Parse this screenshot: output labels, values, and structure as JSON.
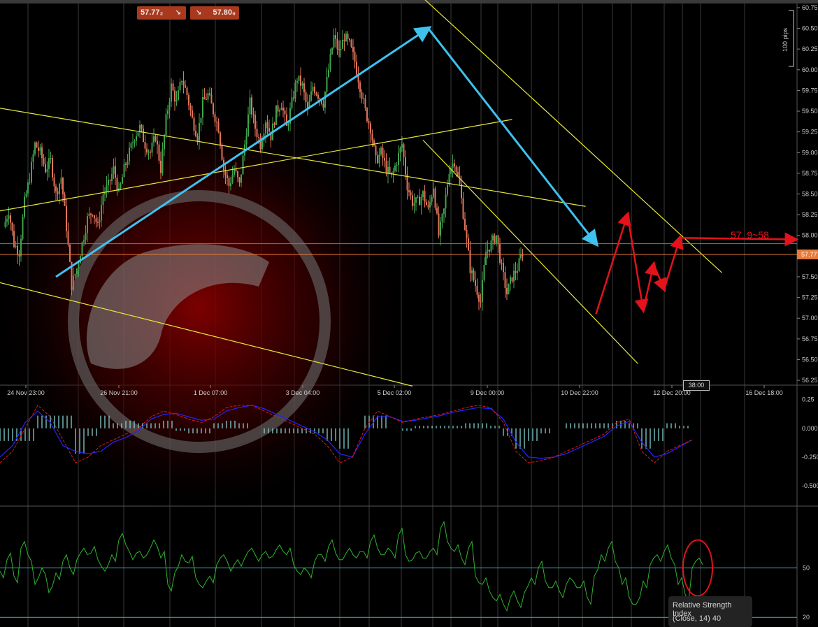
{
  "toolbar": {
    "bid_price": "57.77₂",
    "ask_price": "57.80₉",
    "bid_arrow": "↘",
    "ask_arrow": "↘"
  },
  "colors": {
    "background": "#000000",
    "candle_up": "#3fa34d",
    "candle_down": "#e0745a",
    "trend_line": "#e8e83a",
    "annotation_blue": "#3fc1ee",
    "annotation_red": "#e3121b",
    "macd_signal": "#e01818",
    "macd_line": "#2424ff",
    "macd_histogram": "#8de0e0",
    "rsi_line": "#2fb32f",
    "rsi_levels": "#3bb3d6",
    "current_price_line": "#e87a3a",
    "grid": "#6a6a6a"
  },
  "chart_data": [
    {
      "type": "candlestick",
      "title": "",
      "x_labels": [
        "24 Nov 23:00",
        "26 Nov 21:00",
        "1 Dec 07:00",
        "3 Dec 04:00",
        "5 Dec 02:00",
        "9 Dec 00:00",
        "10 Dec 22:00",
        "12 Dec 20:00",
        "16 Dec 18:00"
      ],
      "y_ticks": [
        "56.25",
        "56.50",
        "56.75",
        "57.00",
        "57.25",
        "57.50",
        "57.75",
        "58.00",
        "58.25",
        "58.50",
        "58.75",
        "59.00",
        "59.25",
        "59.50",
        "59.75",
        "60.00",
        "60.25",
        "60.50",
        "60.75"
      ],
      "ylim": [
        56.2,
        60.8
      ],
      "current_price": 57.77,
      "current_price_label": "57.77",
      "scale_label": "100 pips",
      "cursor_time": "38:00",
      "annotation_text": "57. 9~58",
      "close_path": [
        [
          0,
          58.1
        ],
        [
          1,
          58.3
        ],
        [
          2,
          57.9
        ],
        [
          3,
          57.8
        ],
        [
          4,
          58.4
        ],
        [
          5,
          58.7
        ],
        [
          6,
          59.1
        ],
        [
          7,
          59.0
        ],
        [
          8,
          58.8
        ],
        [
          9,
          58.9
        ],
        [
          10,
          58.5
        ],
        [
          11,
          58.7
        ],
        [
          12,
          58.1
        ],
        [
          13,
          57.4
        ],
        [
          14,
          57.6
        ],
        [
          15,
          57.9
        ],
        [
          16,
          58.2
        ],
        [
          17,
          58.3
        ],
        [
          18,
          58.1
        ],
        [
          19,
          58.5
        ],
        [
          20,
          58.6
        ],
        [
          21,
          58.8
        ],
        [
          22,
          58.5
        ],
        [
          23,
          58.8
        ],
        [
          24,
          59.0
        ],
        [
          25,
          59.2
        ],
        [
          26,
          59.3
        ],
        [
          27,
          59.1
        ],
        [
          28,
          59.0
        ],
        [
          29,
          59.2
        ],
        [
          30,
          58.8
        ],
        [
          31,
          59.4
        ],
        [
          32,
          59.8
        ],
        [
          33,
          59.6
        ],
        [
          34,
          59.9
        ],
        [
          35,
          59.7
        ],
        [
          36,
          59.4
        ],
        [
          37,
          59.2
        ],
        [
          38,
          59.6
        ],
        [
          39,
          59.7
        ],
        [
          40,
          59.5
        ],
        [
          41,
          59.3
        ],
        [
          42,
          58.8
        ],
        [
          43,
          58.6
        ],
        [
          44,
          58.8
        ],
        [
          45,
          58.6
        ],
        [
          46,
          59.1
        ],
        [
          47,
          59.6
        ],
        [
          48,
          59.3
        ],
        [
          49,
          59.1
        ],
        [
          50,
          59.4
        ],
        [
          51,
          59.2
        ],
        [
          52,
          59.5
        ],
        [
          53,
          59.6
        ],
        [
          54,
          59.3
        ],
        [
          55,
          59.6
        ],
        [
          56,
          59.9
        ],
        [
          57,
          59.8
        ],
        [
          58,
          59.5
        ],
        [
          59,
          59.8
        ],
        [
          60,
          59.7
        ],
        [
          61,
          59.6
        ],
        [
          62,
          60.0
        ],
        [
          63,
          60.4
        ],
        [
          64,
          60.2
        ],
        [
          65,
          60.4
        ],
        [
          66,
          60.3
        ],
        [
          67,
          60.1
        ],
        [
          68,
          59.8
        ],
        [
          69,
          59.5
        ],
        [
          70,
          59.3
        ],
        [
          71,
          58.9
        ],
        [
          72,
          59.0
        ],
        [
          73,
          58.8
        ],
        [
          74,
          58.7
        ],
        [
          75,
          58.9
        ],
        [
          76,
          59.1
        ],
        [
          77,
          58.6
        ],
        [
          78,
          58.4
        ],
        [
          79,
          58.4
        ],
        [
          80,
          58.5
        ],
        [
          81,
          58.3
        ],
        [
          82,
          58.6
        ],
        [
          83,
          58.0
        ],
        [
          84,
          58.3
        ],
        [
          85,
          58.8
        ],
        [
          86,
          58.9
        ],
        [
          87,
          58.6
        ],
        [
          88,
          58.1
        ],
        [
          89,
          57.6
        ],
        [
          90,
          57.4
        ],
        [
          91,
          57.2
        ],
        [
          92,
          57.8
        ],
        [
          93,
          57.9
        ],
        [
          94,
          58.0
        ],
        [
          95,
          57.6
        ],
        [
          96,
          57.3
        ],
        [
          97,
          57.5
        ],
        [
          98,
          57.6
        ],
        [
          99,
          57.8
        ]
      ],
      "trend_lines": [
        {
          "from": [
            -2,
            59.55
          ],
          "to": [
            111,
            58.35
          ]
        },
        {
          "from": [
            -2,
            58.28
          ],
          "to": [
            97,
            59.4
          ]
        },
        {
          "from": [
            -2,
            57.45
          ],
          "to": [
            78,
            56.18
          ]
        },
        {
          "from": [
            76,
            61.1
          ],
          "to": [
            137,
            57.55
          ]
        },
        {
          "from": [
            80,
            59.15
          ],
          "to": [
            121,
            56.45
          ]
        }
      ],
      "blue_arrows": [
        {
          "from": [
            10,
            57.5
          ],
          "to": [
            81,
            60.5
          ]
        },
        {
          "from": [
            81,
            60.5
          ],
          "to": [
            113,
            57.9
          ]
        }
      ],
      "red_arrows": [
        {
          "from": [
            113,
            57.05
          ],
          "to": [
            119,
            58.25
          ]
        },
        {
          "from": [
            119,
            58.25
          ],
          "to": [
            122,
            57.1
          ]
        },
        {
          "from": [
            122,
            57.1
          ],
          "to": [
            124,
            57.65
          ]
        },
        {
          "from": [
            124,
            57.65
          ],
          "to": [
            126,
            57.35
          ]
        },
        {
          "from": [
            126,
            57.35
          ],
          "to": [
            129,
            57.97
          ]
        },
        {
          "from": [
            129,
            57.97
          ],
          "to": [
            151,
            57.95
          ]
        }
      ]
    },
    {
      "type": "line",
      "title": "",
      "y_ticks": [
        "0.25",
        "0.000",
        "-0.250",
        "-0.500"
      ],
      "ylim": [
        -0.62,
        0.32
      ],
      "series": [
        {
          "name": "",
          "values": [
            -0.3,
            -0.2,
            0.0,
            0.2,
            0.1,
            -0.1,
            -0.3,
            -0.25,
            -0.15,
            -0.1,
            -0.05,
            0.0,
            0.1,
            0.15,
            0.12,
            0.08,
            0.05,
            0.1,
            0.18,
            0.2,
            0.2,
            0.15,
            0.1,
            0.05,
            0.0,
            -0.05,
            -0.15,
            -0.3,
            -0.25,
            0.0,
            0.15,
            0.1,
            0.05,
            0.08,
            0.1,
            0.12,
            0.15,
            0.18,
            0.2,
            0.18,
            0.05,
            -0.2,
            -0.3,
            -0.28,
            -0.25,
            -0.2,
            -0.15,
            -0.1,
            -0.05,
            0.05,
            0.08,
            -0.2,
            -0.3,
            -0.2,
            -0.15,
            -0.1
          ]
        },
        {
          "name": "",
          "values": [
            -0.25,
            -0.15,
            0.05,
            0.15,
            0.05,
            -0.15,
            -0.2,
            -0.22,
            -0.2,
            -0.12,
            -0.08,
            -0.02,
            0.08,
            0.12,
            0.13,
            0.1,
            0.07,
            0.08,
            0.15,
            0.18,
            0.2,
            0.17,
            0.12,
            0.07,
            0.02,
            -0.03,
            -0.1,
            -0.22,
            -0.25,
            -0.05,
            0.1,
            0.1,
            0.06,
            0.07,
            0.09,
            0.11,
            0.14,
            0.16,
            0.18,
            0.17,
            0.08,
            -0.12,
            -0.25,
            -0.26,
            -0.25,
            -0.22,
            -0.17,
            -0.12,
            -0.07,
            0.02,
            0.06,
            -0.12,
            -0.25,
            -0.22,
            -0.16,
            -0.1
          ]
        }
      ]
    },
    {
      "type": "line",
      "title": "",
      "y_ticks": [
        "50",
        "20"
      ],
      "ylim": [
        15,
        85
      ],
      "indicator_name": "Relative Strength Index",
      "indicator_params": "(Close, 14)",
      "indicator_value": "40",
      "levels": [
        50,
        20
      ],
      "values": [
        48,
        55,
        45,
        62,
        58,
        40,
        50,
        35,
        47,
        54,
        50,
        55,
        62,
        59,
        55,
        48,
        58,
        67,
        64,
        55,
        60,
        58,
        67,
        56,
        40,
        47,
        58,
        53,
        44,
        38,
        45,
        52,
        58,
        48,
        55,
        56,
        62,
        54,
        60,
        57,
        64,
        58,
        52,
        46,
        48,
        54,
        58,
        63,
        59,
        55,
        62,
        56,
        60,
        66,
        62,
        58,
        60,
        70,
        58,
        55,
        60,
        56,
        62,
        74,
        66,
        60,
        56,
        62,
        45,
        40,
        36,
        30,
        28,
        32,
        30,
        35,
        44,
        50,
        42,
        38,
        36,
        40,
        42,
        38,
        32,
        45,
        58,
        62,
        54,
        40,
        32,
        28,
        42,
        52,
        58,
        60,
        56,
        40,
        34,
        50,
        56
      ]
    }
  ]
}
